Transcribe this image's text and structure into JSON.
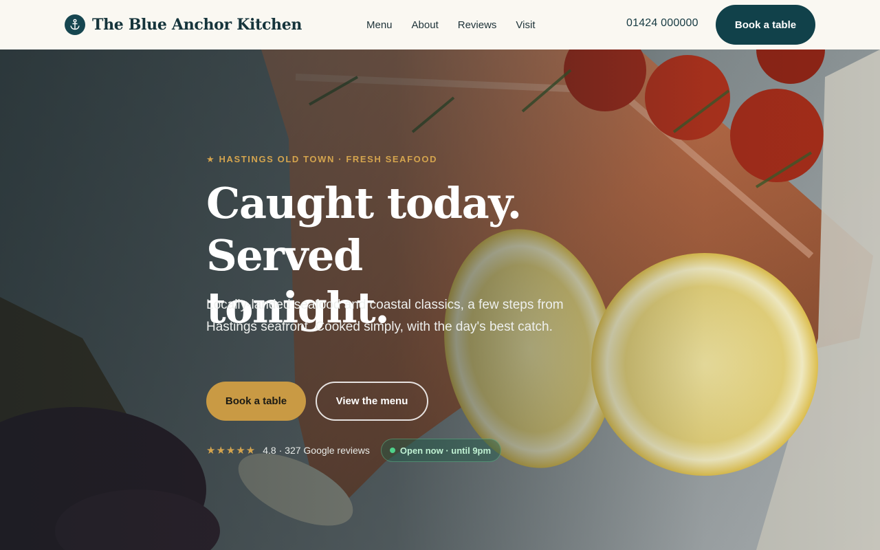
{
  "brand": {
    "name": "The Blue Anchor Kitchen",
    "icon": "anchor-icon"
  },
  "nav": {
    "items": [
      "Menu",
      "About",
      "Reviews",
      "Visit"
    ]
  },
  "header": {
    "phone": "01424 000000",
    "book_label": "Book a table"
  },
  "hero": {
    "eyebrow": "★ HASTINGS OLD TOWN · FRESH SEAFOOD",
    "headline_line1": "Caught today. Served",
    "headline_line2": "tonight.",
    "lede": "Locally-landed seafood and coastal classics, a few steps from Hastings seafront. Cooked simply, with the day's best catch.",
    "primary_cta": "Book a table",
    "secondary_cta": "View the menu",
    "stars": "★★★★★",
    "rating_value": 4.8,
    "rating_text": "4.8 · 327 Google reviews",
    "open_status": "Open now · until 9pm"
  },
  "colors": {
    "brand": "#11414a",
    "accent": "#c99a44",
    "header_bg": "#faf8f2",
    "open_status": "#4fd18a"
  }
}
